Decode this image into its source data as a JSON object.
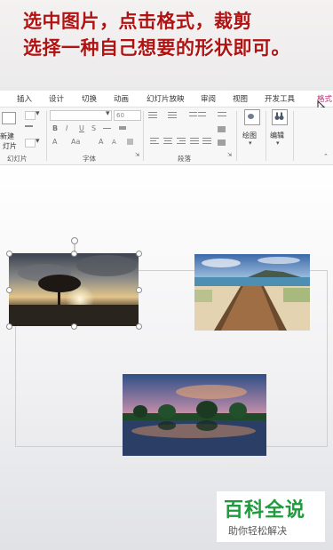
{
  "caption": {
    "line1": "选中图片，点击格式，裁剪",
    "line2": "选择一种自己想要的形状即可。"
  },
  "ribbon_tabs": [
    "插入",
    "设计",
    "切换",
    "动画",
    "幻灯片放映",
    "审阅",
    "视图",
    "开发工具",
    "格式"
  ],
  "active_tab": "格式",
  "ribbon": {
    "new_slide_label_line1": "新建",
    "new_slide_label_line2": "灯片",
    "font_size": "60",
    "group_slides": "幻灯片",
    "group_font": "字体",
    "group_paragraph": "段落",
    "draw_label": "绘图",
    "edit_label": "编辑",
    "bold": "B",
    "italic": "I",
    "underline": "U",
    "strike": "S",
    "font_color": "A",
    "aa": "Aa",
    "grow": "A",
    "shrink": "A"
  },
  "images": [
    {
      "name": "tree-sunset",
      "description_icon": "image-icon"
    },
    {
      "name": "boardwalk-beach",
      "description_icon": "image-icon"
    },
    {
      "name": "lake-reflection",
      "description_icon": "image-icon"
    }
  ],
  "watermark": {
    "title": "百科全说",
    "subtitle": "助你轻松解决"
  },
  "colors": {
    "caption_text": "#b11212",
    "active_tab": "#c02670",
    "brand_green": "#1e9b3d"
  }
}
